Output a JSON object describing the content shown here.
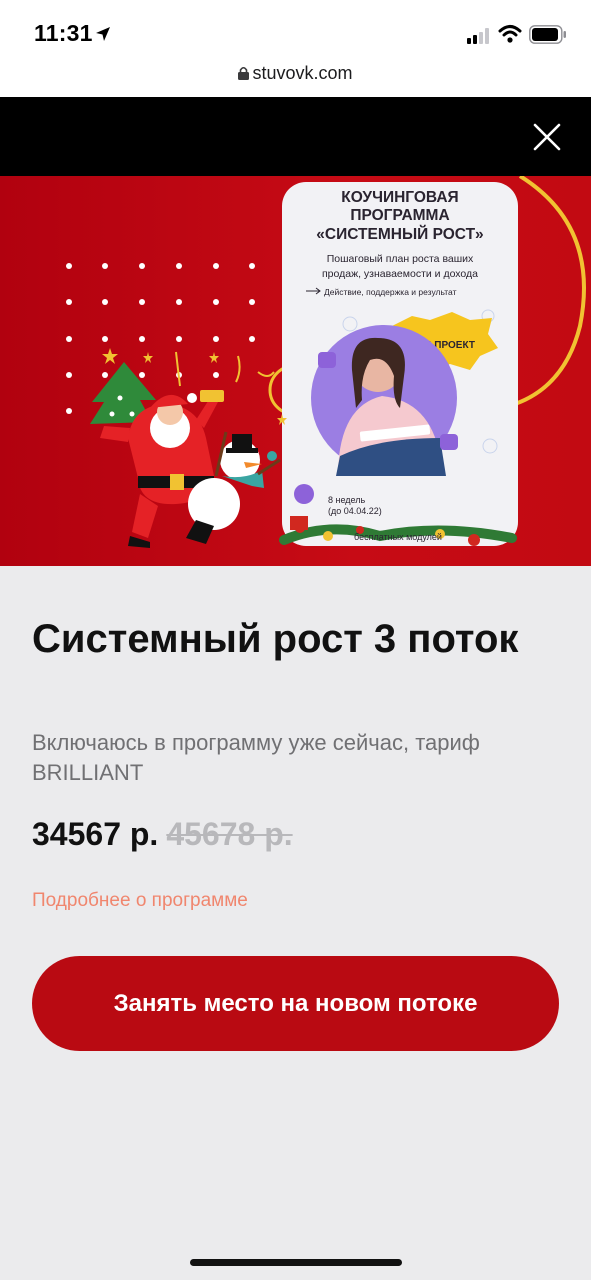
{
  "status_bar": {
    "time": "11:31",
    "icons": [
      "location-arrow-icon",
      "cellular-signal-icon",
      "wifi-icon",
      "battery-icon"
    ]
  },
  "browser": {
    "url": "stuvovk.com",
    "icons": [
      "lock-icon"
    ]
  },
  "modal": {
    "close_icon": "close-icon"
  },
  "banner": {
    "card_title_line1": "КОУЧИНГОВАЯ",
    "card_title_line2": "ПРОГРАММА",
    "card_title_line3": "«СИСТЕМНЫЙ РОСТ»",
    "card_desc_line1": "Пошаговый план роста ваших",
    "card_desc_line2": "продаж, узнаваемости и дохода",
    "card_points": "Действие, поддержка и результат",
    "badge": "ТЫ-ПРОЕКТ",
    "weeks_line1": "8 недель",
    "weeks_line2": "(до 04.04.22)",
    "footer_text": "бесплатных модулей",
    "colors": {
      "red": "#c20a12",
      "gold": "#f1c232",
      "purple": "#8d62d9"
    }
  },
  "product": {
    "title": "Системный рост 3 поток",
    "subtitle": "Включаюсь в программу уже сейчас, тариф BRILLIANT",
    "price": "34567 р.",
    "old_price": "45678 р.",
    "more_link": "Подробнее о программе",
    "cta": "Занять место на новом потоке"
  },
  "colors": {
    "accent": "#b90a12",
    "link": "#f0866e",
    "background": "#ebebed"
  }
}
